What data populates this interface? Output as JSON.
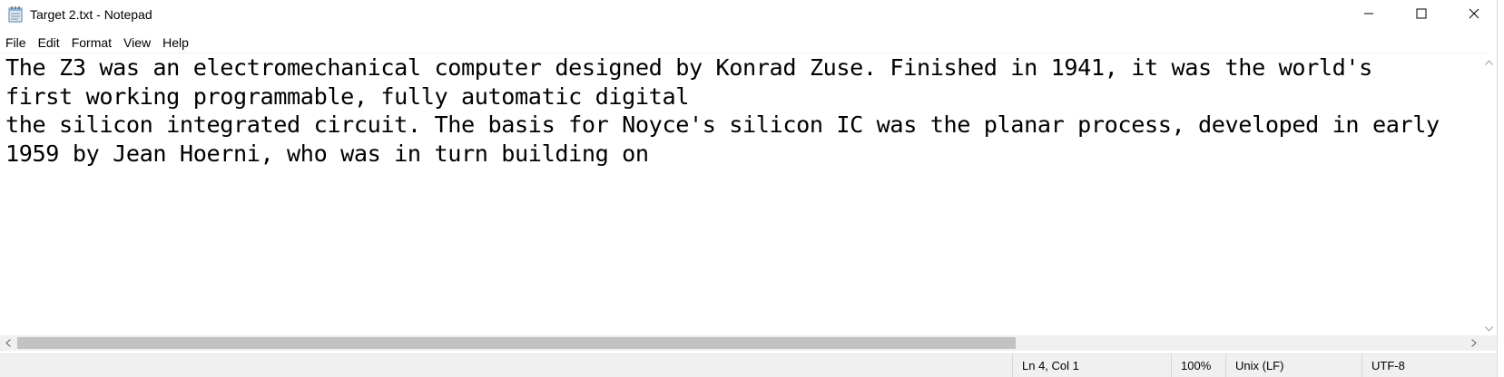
{
  "window": {
    "title": "Target 2.txt - Notepad",
    "app_icon": "notepad-icon"
  },
  "controls": {
    "minimize_icon": "minimize-icon",
    "maximize_icon": "maximize-icon",
    "close_icon": "close-icon"
  },
  "menu": {
    "items": [
      {
        "label": "File"
      },
      {
        "label": "Edit"
      },
      {
        "label": "Format"
      },
      {
        "label": "View"
      },
      {
        "label": "Help"
      }
    ]
  },
  "editor": {
    "lines": [
      "The Z3 was an electromechanical computer designed by Konrad Zuse. Finished in 1941, it was the world's",
      "first working programmable, fully automatic digital",
      "the silicon integrated circuit. The basis for Noyce's silicon IC was the planar process, developed in early",
      "1959 by Jean Hoerni, who was in turn building on"
    ]
  },
  "statusbar": {
    "position": "Ln 4, Col 1",
    "zoom": "100%",
    "line_ending": "Unix (LF)",
    "encoding": "UTF-8"
  },
  "colors": {
    "background": "#ffffff",
    "chrome": "#f0f0f0",
    "scroll_thumb": "#c2c2c2",
    "text": "#000000"
  }
}
